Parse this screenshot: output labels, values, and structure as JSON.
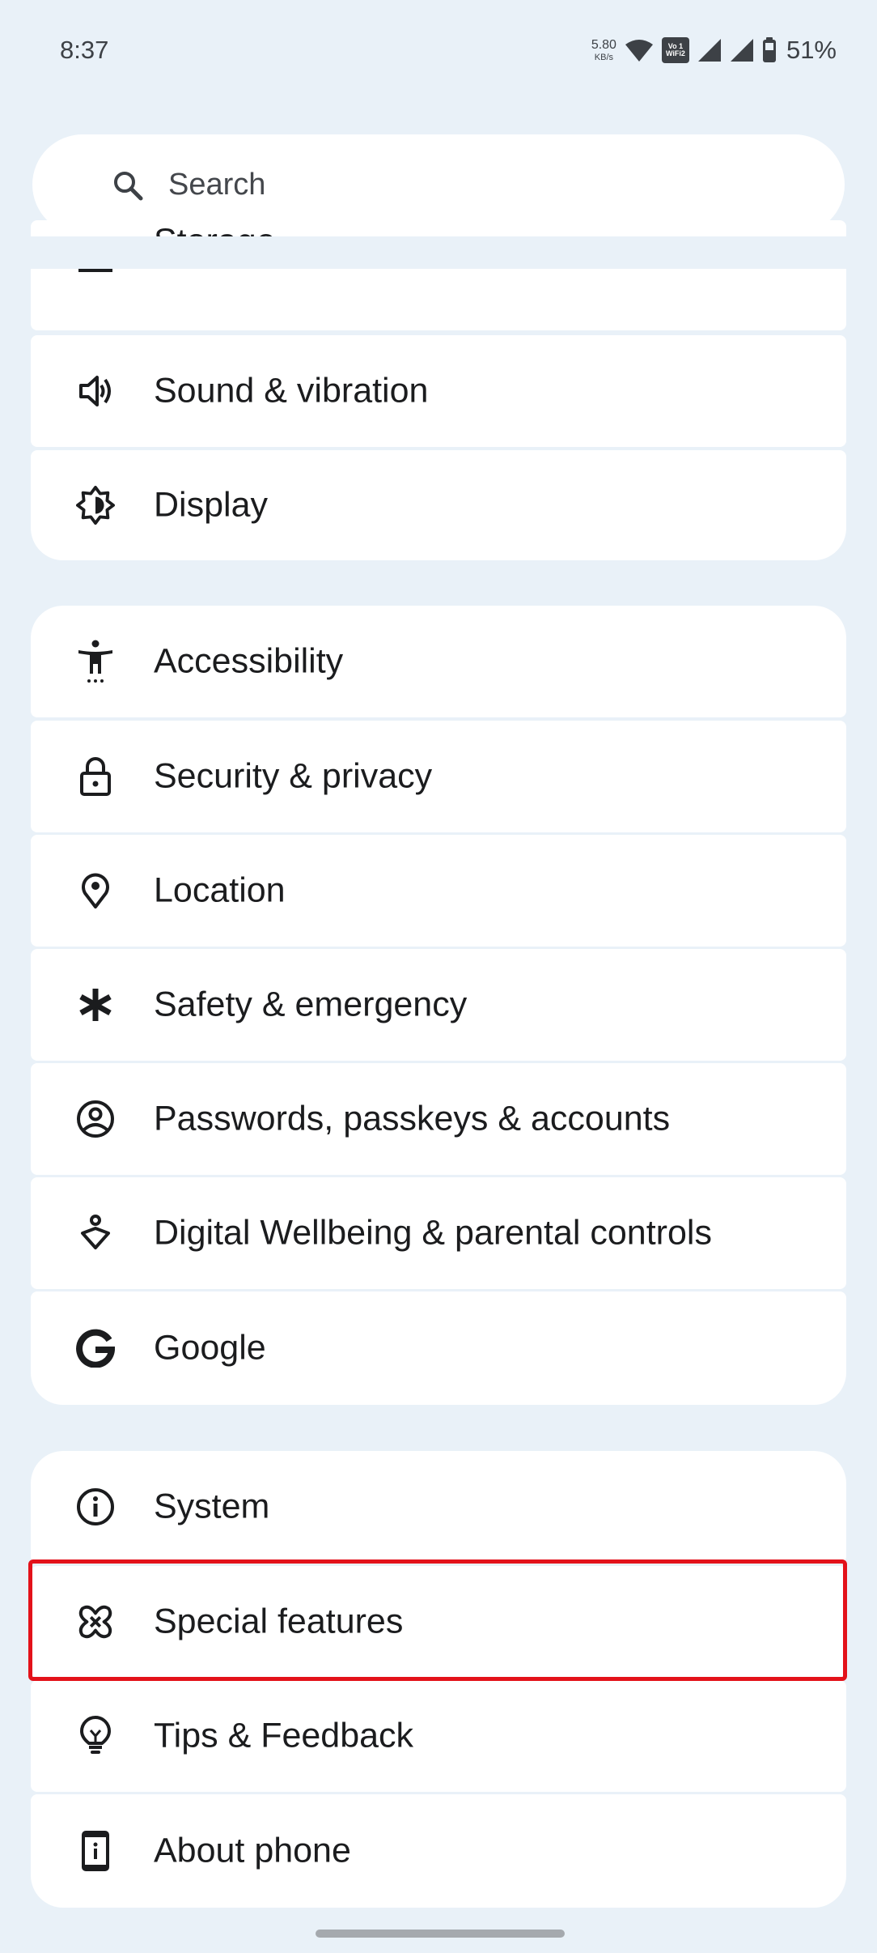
{
  "status_bar": {
    "time": "8:37",
    "net_speed_value": "5.80",
    "net_speed_unit": "KB/s",
    "wifi_badge_top": "Vo  1",
    "wifi_badge_bottom": "WiFi2",
    "battery_percent": "51%",
    "icons": [
      "wifi-icon",
      "vowifi-icon",
      "signal-sim1-icon",
      "signal-sim2-icon",
      "battery-icon"
    ]
  },
  "search": {
    "placeholder": "Search",
    "icon": "search-icon"
  },
  "groups": [
    {
      "items": [
        {
          "label": "Storage",
          "icon": "storage-icon"
        },
        {
          "label": "Sound & vibration",
          "icon": "volume-icon"
        },
        {
          "label": "Display",
          "icon": "brightness-icon"
        }
      ]
    },
    {
      "items": [
        {
          "label": "Accessibility",
          "icon": "accessibility-icon"
        },
        {
          "label": "Security & privacy",
          "icon": "lock-icon"
        },
        {
          "label": "Location",
          "icon": "location-pin-icon"
        },
        {
          "label": "Safety & emergency",
          "icon": "asterisk-icon"
        },
        {
          "label": "Passwords, passkeys & accounts",
          "icon": "account-circle-icon"
        },
        {
          "label": "Digital Wellbeing & parental controls",
          "icon": "wellbeing-icon"
        },
        {
          "label": "Google",
          "icon": "google-icon"
        }
      ]
    },
    {
      "items": [
        {
          "label": "System",
          "icon": "info-icon"
        },
        {
          "label": "Special features",
          "icon": "special-features-icon",
          "highlighted": true
        },
        {
          "label": "Tips & Feedback",
          "icon": "lightbulb-icon"
        },
        {
          "label": "About phone",
          "icon": "phone-info-icon"
        }
      ]
    }
  ],
  "colors": {
    "background": "#e9f1f8",
    "card": "#ffffff",
    "highlight_border": "#e3121a",
    "text": "#1b1c1e"
  }
}
